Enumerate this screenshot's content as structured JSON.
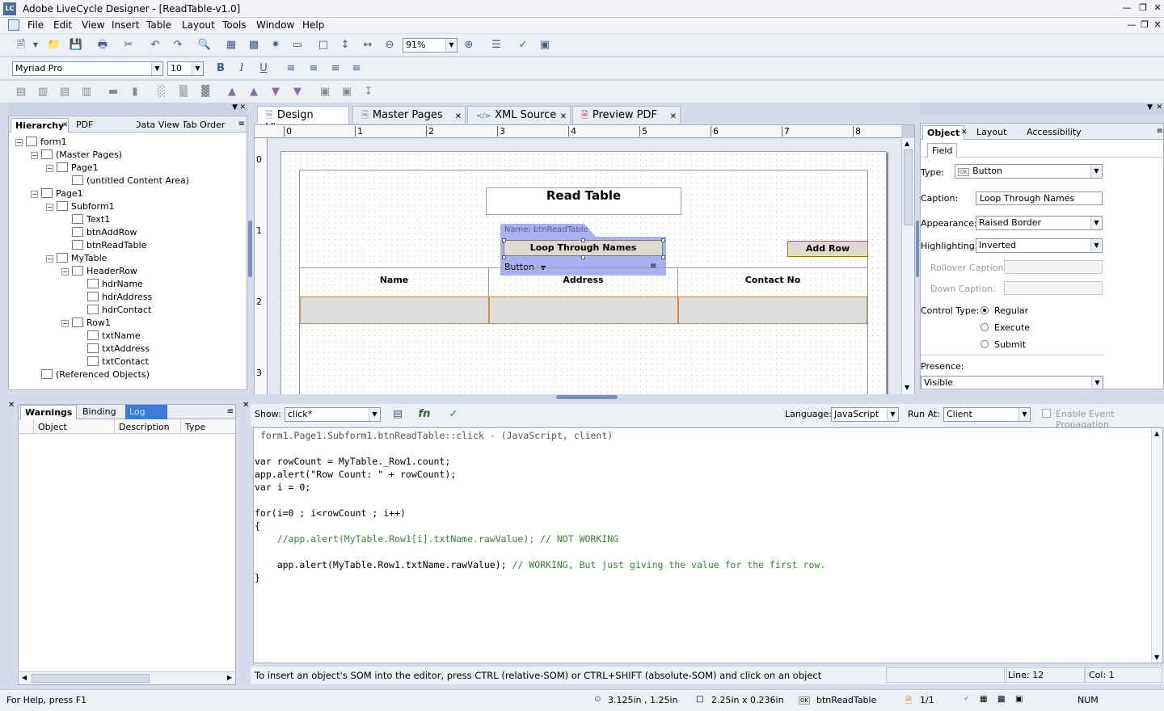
{
  "window": {
    "title": "Adobe LiveCycle Designer - [ReadTable-v1.0]",
    "logo": "LC"
  },
  "menu": [
    "File",
    "Edit",
    "View",
    "Insert",
    "Table",
    "Layout",
    "Tools",
    "Window",
    "Help"
  ],
  "toolbar": {
    "zoom": "91%"
  },
  "fontbar": {
    "font": "Myriad Pro",
    "size": "10",
    "bold": "B",
    "italic": "I",
    "underline": "U"
  },
  "hierarchy": {
    "tabs": [
      "Hierarchy",
      "PDF Structure",
      "Data View",
      "Tab Order"
    ],
    "items": [
      {
        "label": "form1",
        "level": 0,
        "icon": "form-icon"
      },
      {
        "label": "(Master Pages)",
        "level": 1,
        "icon": "master-pages-icon"
      },
      {
        "label": "Page1",
        "level": 2,
        "icon": "page-icon"
      },
      {
        "label": "(untitled Content Area)",
        "level": 3,
        "icon": "content-area-icon"
      },
      {
        "label": "Page1",
        "level": 1,
        "icon": "page-icon"
      },
      {
        "label": "Subform1",
        "level": 2,
        "icon": "subform-icon"
      },
      {
        "label": "Text1",
        "level": 3,
        "icon": "text-icon"
      },
      {
        "label": "btnAddRow",
        "level": 3,
        "icon": "button-icon"
      },
      {
        "label": "btnReadTable",
        "level": 3,
        "icon": "button-icon"
      },
      {
        "label": "MyTable",
        "level": 2,
        "icon": "table-icon"
      },
      {
        "label": "HeaderRow",
        "level": 3,
        "icon": "row-icon"
      },
      {
        "label": "hdrName",
        "level": 4,
        "icon": "text-icon"
      },
      {
        "label": "hdrAddress",
        "level": 4,
        "icon": "text-icon"
      },
      {
        "label": "hdrContact",
        "level": 4,
        "icon": "text-icon"
      },
      {
        "label": "Row1",
        "level": 3,
        "icon": "row-icon"
      },
      {
        "label": "txtName",
        "level": 4,
        "icon": "textfield-icon"
      },
      {
        "label": "txtAddress",
        "level": 4,
        "icon": "textfield-icon"
      },
      {
        "label": "txtContact",
        "level": 4,
        "icon": "textfield-icon"
      },
      {
        "label": "(Referenced Objects)",
        "level": 1,
        "icon": "referenced-objects-icon"
      }
    ]
  },
  "doctabs": [
    "Design View",
    "Master Pages",
    "XML Source",
    "Preview PDF"
  ],
  "ruler": {
    "h": [
      "0",
      "1",
      "2",
      "3",
      "4",
      "5",
      "6",
      "7",
      "8"
    ],
    "v": [
      "0",
      "1",
      "2",
      "3"
    ]
  },
  "form": {
    "heading": "Read Table",
    "selected_name": "Name: btnReadTable",
    "button1": "Loop Through Names",
    "button2": "Add Row",
    "type_menu": "Button",
    "columns": [
      "Name",
      "Address",
      "Contact No"
    ]
  },
  "object_panel": {
    "tabs": [
      "Object",
      "Layout",
      "Accessibility"
    ],
    "subtab": "Field",
    "type_label": "Type:",
    "type_value": "Button",
    "caption_label": "Caption:",
    "caption_value": "Loop Through Names",
    "appearance_label": "Appearance:",
    "appearance_value": "Raised Border",
    "highlighting_label": "Highlighting:",
    "highlighting_value": "Inverted",
    "rollover_label": "Rollover Caption:",
    "down_label": "Down Caption:",
    "control_type_label": "Control Type:",
    "control_types": [
      "Regular",
      "Execute",
      "Submit"
    ],
    "presence_label": "Presence:",
    "presence_value": "Visible"
  },
  "warnings": {
    "tabs": [
      "Warnings",
      "Binding",
      "Log"
    ],
    "columns": [
      "Object",
      "Description",
      "Type"
    ]
  },
  "script": {
    "show_label": "Show:",
    "show_value": "click*",
    "language_label": "Language:",
    "language_value": "JavaScript",
    "runat_label": "Run At:",
    "runat_value": "Client",
    "propagation_label": "Enable Event Propagation",
    "header": "form1.Page1.Subform1.btnReadTable::click - (JavaScript, client)",
    "lines": [
      "var rowCount = MyTable._Row1.count;",
      "app.alert(\"Row Count: \" + rowCount);",
      "var i = 0;",
      "",
      "for(i=0 ; i<rowCount ; i++)",
      "{",
      "    //app.alert(MyTable.Row1[i].txtName.rawValue); // NOT WORKING",
      "",
      "    app.alert(MyTable.Row1.txtName.rawValue); // WORKING, But just giving the value for the first row.",
      "}",
      ""
    ],
    "hint": "To insert an object's SOM into the editor, press CTRL (relative-SOM) or CTRL+SHIFT (absolute-SOM) and click on an object",
    "line_status": "Line: 12",
    "col_status": "Col: 1"
  },
  "status": {
    "help": "For Help, press F1",
    "position": "3.125in , 1.25in",
    "size": "2.25in x 0.236in",
    "object": "btnReadTable",
    "page": "1/1",
    "num": "NUM"
  }
}
